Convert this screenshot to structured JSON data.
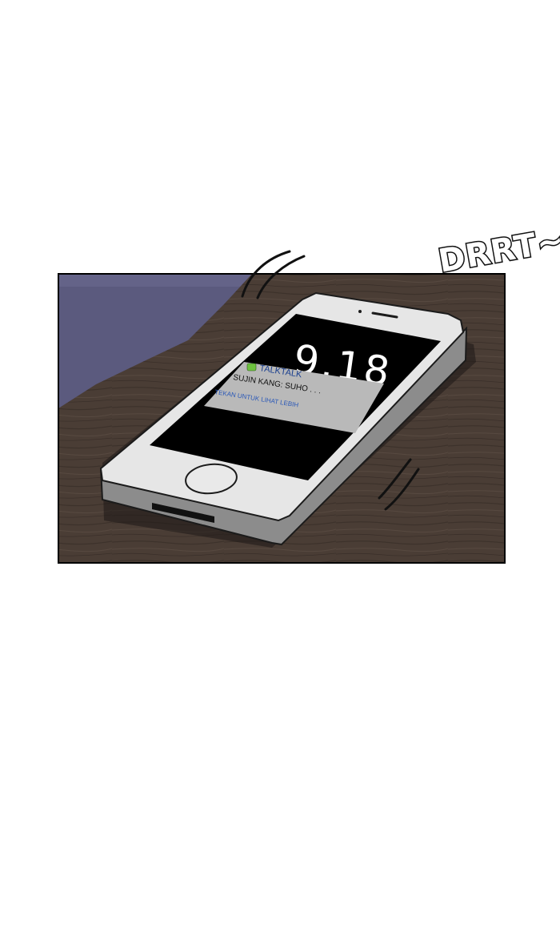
{
  "sound_effect": "DRRT~",
  "phone": {
    "clock_time": "9.18",
    "notification": {
      "app_name": "TALKTALK",
      "message": "SUJIN KANG: SUHO . . .",
      "hint": "TEKAN UNTUK LIHAT LEBIH"
    }
  },
  "colors": {
    "table_wood": "#4a3d35",
    "wall": "#5b5a7e",
    "phone_body": "#e6e6e6",
    "screen": "#000000",
    "notification_bg": "#b9b9b9",
    "app_icon": "#6ec23f"
  }
}
